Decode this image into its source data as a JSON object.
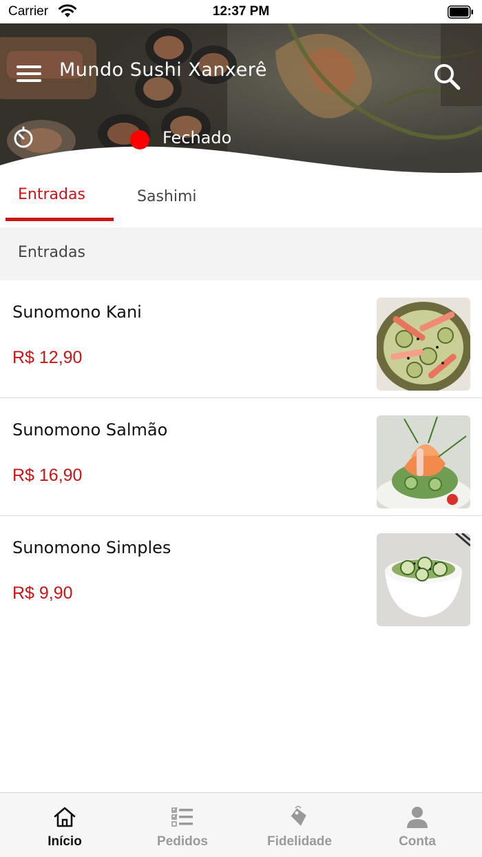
{
  "status_bar": {
    "carrier": "Carrier",
    "time": "12:37 PM"
  },
  "header": {
    "title": "Mundo Sushi Xanxerê",
    "status_text": "Fechado",
    "status_color": "#fe0000"
  },
  "tabs": [
    {
      "label": "Entradas",
      "active": true
    },
    {
      "label": "Sashimi",
      "active": false
    }
  ],
  "section": {
    "title": "Entradas"
  },
  "items": [
    {
      "name": "Sunomono Kani",
      "price": "R$ 12,90"
    },
    {
      "name": "Sunomono Salmão",
      "price": "R$ 16,90"
    },
    {
      "name": "Sunomono Simples",
      "price": "R$ 9,90"
    }
  ],
  "tabbar": [
    {
      "label": "Início",
      "icon": "home-icon",
      "active": true
    },
    {
      "label": "Pedidos",
      "icon": "checklist-icon",
      "active": false
    },
    {
      "label": "Fidelidade",
      "icon": "tag-icon",
      "active": false
    },
    {
      "label": "Conta",
      "icon": "person-icon",
      "active": false
    }
  ],
  "colors": {
    "accent": "#cc1414",
    "inactive": "#9a9a9a"
  }
}
